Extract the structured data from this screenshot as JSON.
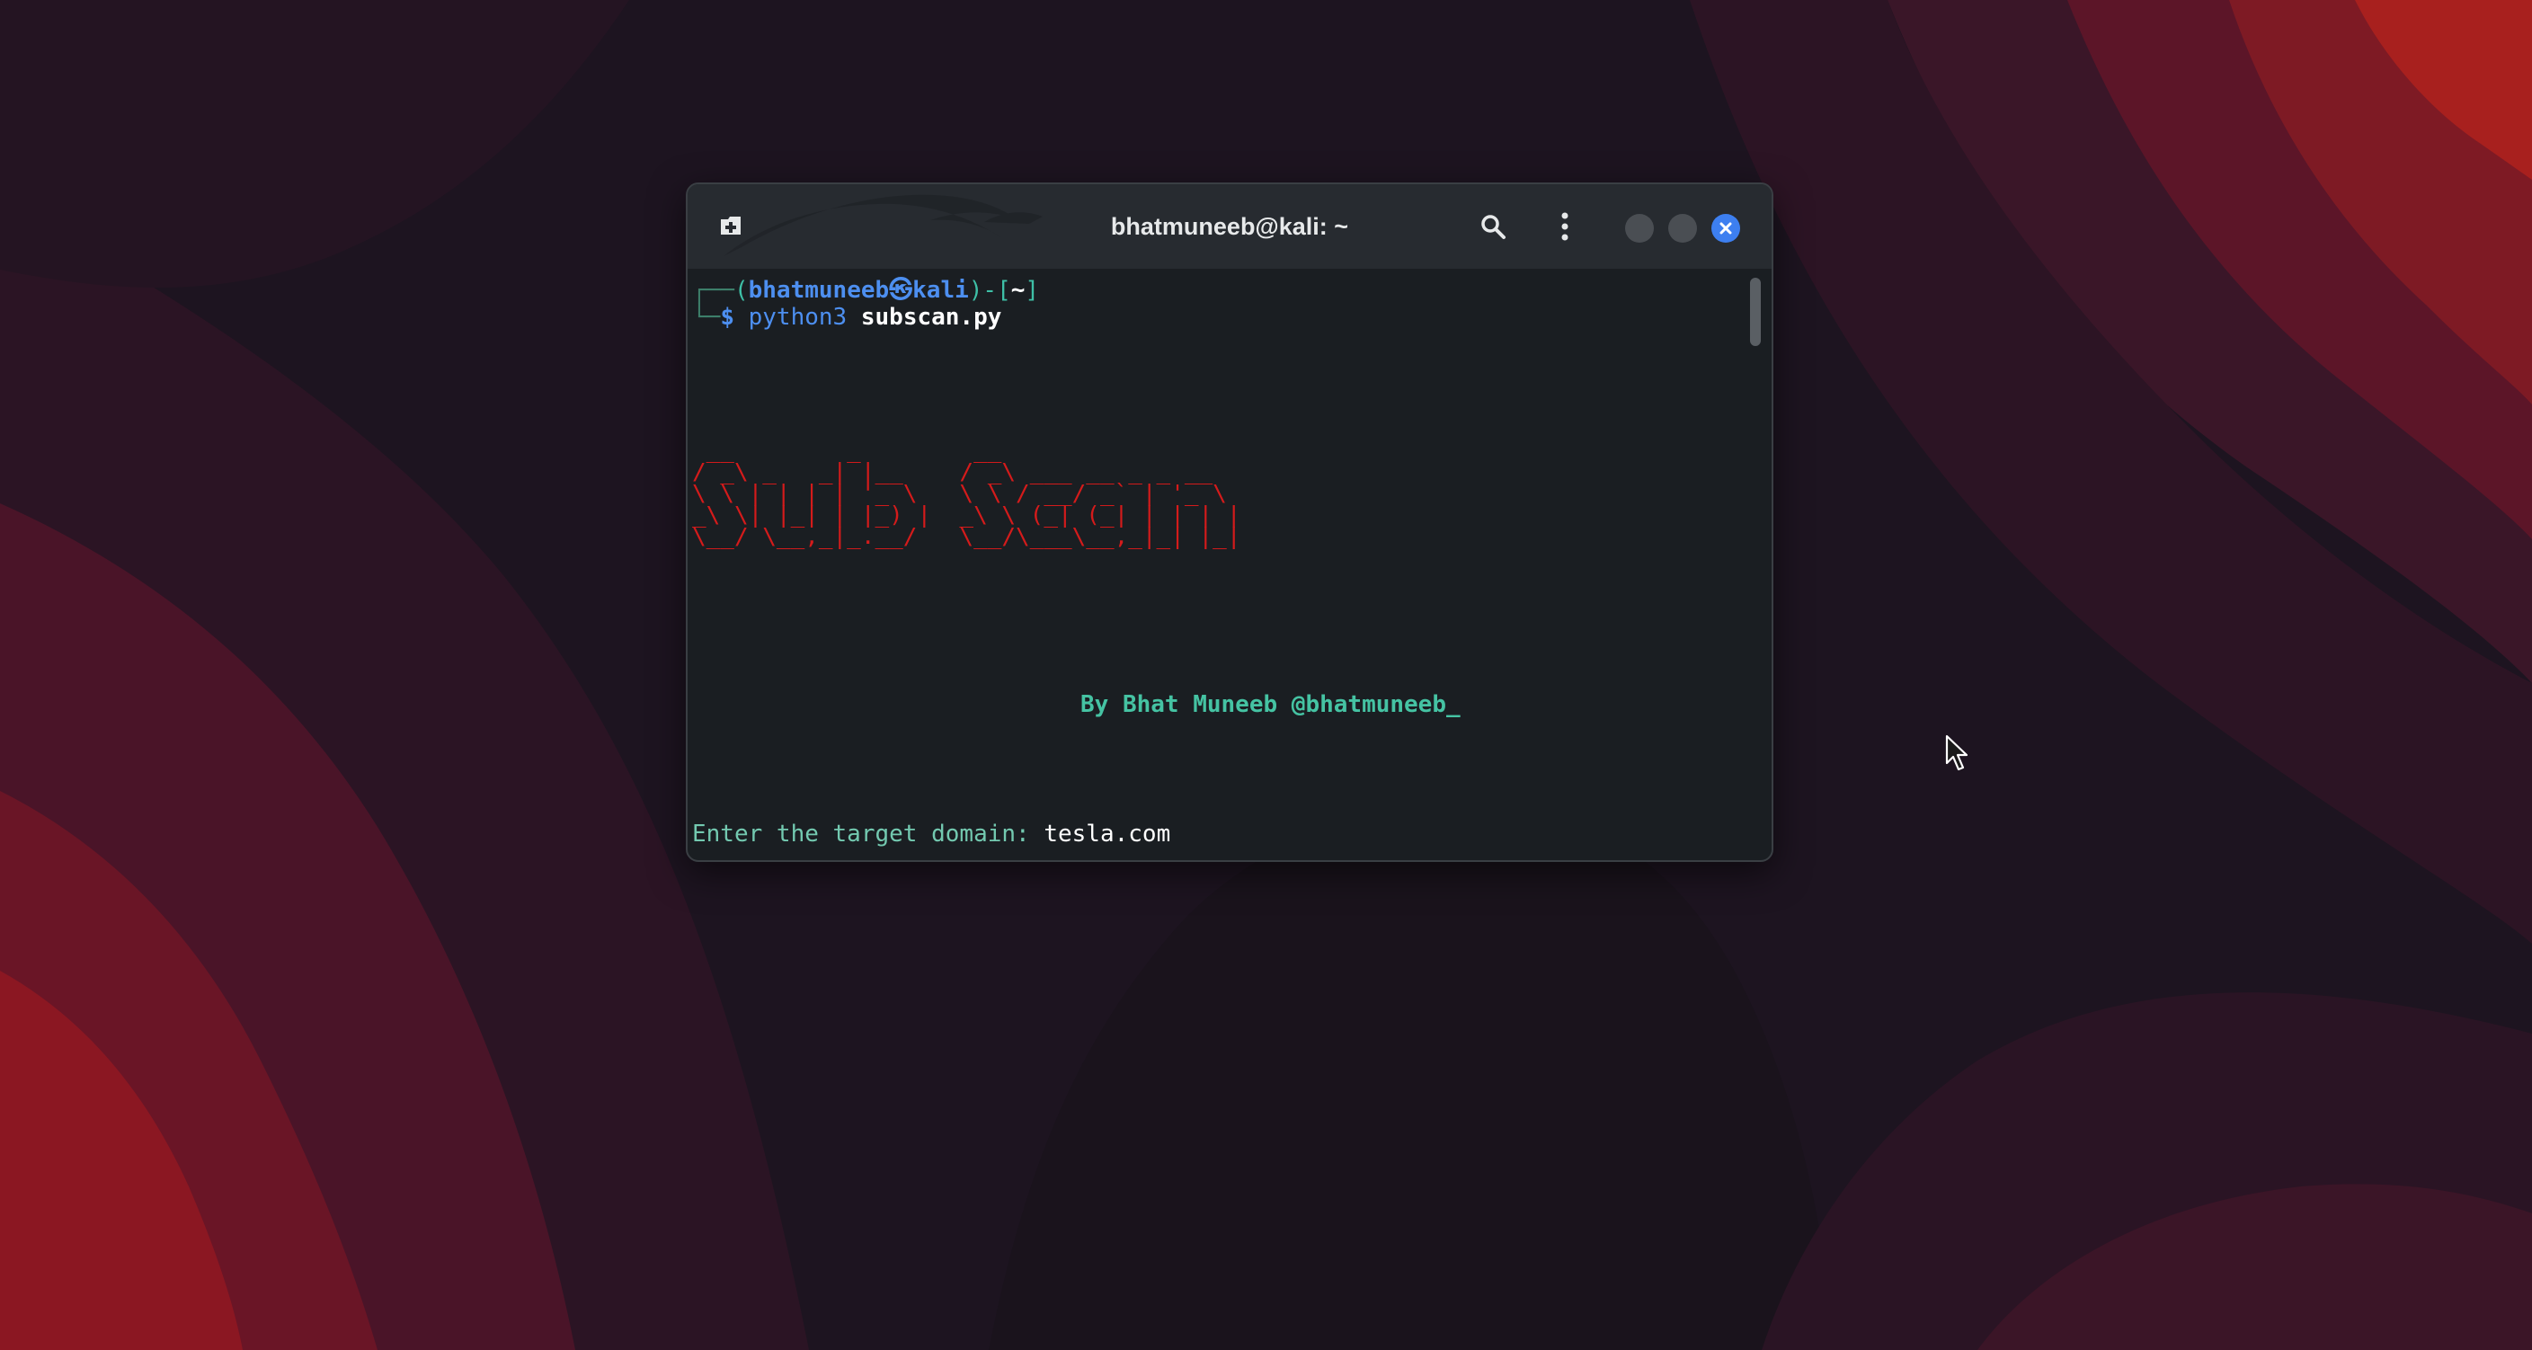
{
  "window": {
    "title": "bhatmuneeb@kali: ~"
  },
  "titlebar": {
    "new_tab_icon": "new-tab-icon",
    "search_icon": "search-icon",
    "menu_icon": "kebab-menu-icon",
    "minimize_icon": "minimize-icon",
    "maximize_icon": "maximize-icon",
    "close_icon": "close-icon",
    "close_color": "#3d7ff0"
  },
  "terminal": {
    "prompt": {
      "corner_top": "┌──",
      "open_paren": "(",
      "user_host": "bhatmuneeb㉿kali",
      "close_dash": ")-[",
      "dir": "~",
      "close_bracket": "]",
      "corner_bottom": "└─",
      "dollar": "$",
      "command": "python3",
      "argument": "subscan.py"
    },
    "banner_lines": [
      " __        _        __",
      "/ _\\ _   _| |__    / _\\ ___ __ _ _ __",
      "\\ \\ | | | | '_ \\   \\ \\ / __/ _` | '_ \\",
      "_\\ \\| |_| | |_) |  _\\ \\ (_| (_| | | | |",
      "\\__/ \\__,_|_.__/   \\__/\\___\\__,_|_| |_|"
    ],
    "banner_color": "#d41b1b",
    "byline": "By Bhat Muneeb @bhatmuneeb_",
    "input_prompt": "Enter the target domain: ",
    "input_value": "tesla.com"
  },
  "colors": {
    "terminal_bg": "#1a1e22",
    "titlebar_bg": "#272b30",
    "accent_blue": "#4d8ff0",
    "accent_teal": "#45c3a3"
  }
}
